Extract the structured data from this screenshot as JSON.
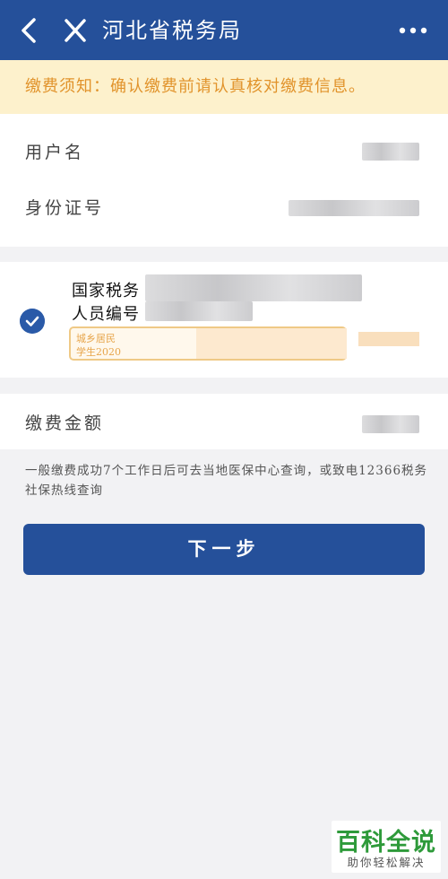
{
  "header": {
    "title": "河北省税务局"
  },
  "notice": {
    "text": "缴费须知：确认缴费前请认真核对缴费信息。"
  },
  "info": {
    "username_label": "用户名",
    "id_label": "身份证号"
  },
  "person": {
    "line1": "国家税务",
    "line2": "人员编号",
    "tag_line1": "城乡居民",
    "tag_line2": "学生2020"
  },
  "amount": {
    "label": "缴费金额"
  },
  "hint": {
    "text": "一般缴费成功7个工作日后可去当地医保中心查询，或致电12366税务社保热线查询"
  },
  "next": {
    "label": "下一步"
  },
  "watermark": {
    "main": "百科全说",
    "sub": "助你轻松解决"
  },
  "colors": {
    "brand_blue": "#25509a",
    "notice_bg": "#fdf1cc",
    "notice_text": "#e1932b",
    "watermark_green": "#2e9a3a"
  }
}
